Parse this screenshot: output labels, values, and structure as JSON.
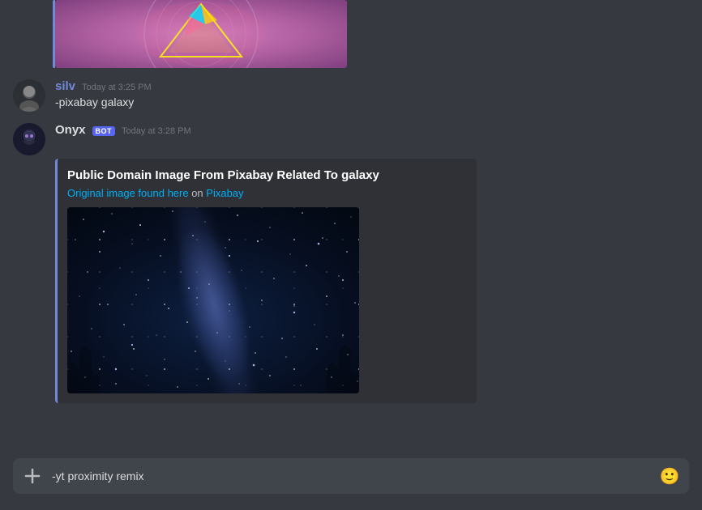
{
  "messages": [
    {
      "id": "msg-silv-prev",
      "type": "image-only",
      "has_top_image": true
    },
    {
      "id": "msg-silv",
      "username": "silv",
      "username_color": "#7289da",
      "timestamp": "Today at 3:25 PM",
      "text": "-pixabay galaxy",
      "avatar_alt": "silv-avatar",
      "is_bot": false
    },
    {
      "id": "msg-onyx",
      "username": "Onyx",
      "username_color": "#dcddde",
      "timestamp": "Today at 3:28 PM",
      "text": "",
      "avatar_alt": "onyx-avatar",
      "is_bot": true,
      "bot_badge": "BOT",
      "embed": {
        "title": "Public Domain Image From Pixabay Related To galaxy",
        "link_text": "Original image found here",
        "link_mid": " on ",
        "link_label": "Pixabay",
        "link_url": "#"
      }
    }
  ],
  "input": {
    "placeholder": "",
    "value": "-yt proximity remix",
    "plus_label": "+",
    "emoji_label": "🙂"
  }
}
